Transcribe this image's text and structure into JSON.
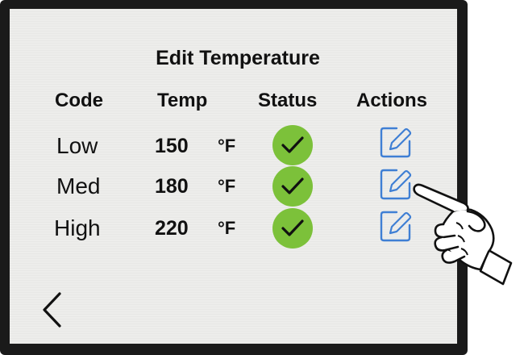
{
  "title": "Edit Temperature",
  "headers": {
    "code": "Code",
    "temp": "Temp",
    "status": "Status",
    "actions": "Actions"
  },
  "rows": [
    {
      "code": "Low",
      "temp": "150",
      "unit": "°F",
      "status_icon": "check-icon",
      "action_icon": "edit-icon"
    },
    {
      "code": "Med",
      "temp": "180",
      "unit": "°F",
      "status_icon": "check-icon",
      "action_icon": "edit-icon"
    },
    {
      "code": "High",
      "temp": "220",
      "unit": "°F",
      "status_icon": "check-icon",
      "action_icon": "edit-icon"
    }
  ],
  "back_icon": "chevron-left-icon",
  "colors": {
    "status_ok": "#7cc13a",
    "edit_icon": "#3f7fd4",
    "screen_bg": "#ededeb",
    "bezel": "#1a1a1a"
  }
}
